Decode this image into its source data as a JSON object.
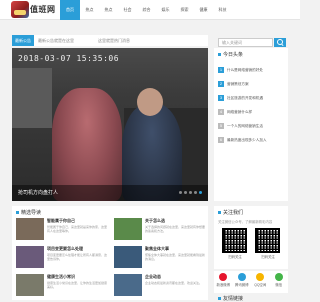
{
  "site": {
    "name": "值班网"
  },
  "nav": [
    "首页",
    "热点",
    "热点",
    "社会",
    "综合",
    "娱乐",
    "探索",
    "健康",
    "科技"
  ],
  "search": {
    "placeholder": "输入关键词"
  },
  "notice": {
    "badge": "最新公告",
    "text1": "最新公告就是在这里",
    "text2": "这里就是热门消息"
  },
  "hero": {
    "camera_text": "2018-03-07  15:35:06",
    "caption": "抢司机方向盘打人",
    "dot_count": 5,
    "active_dot": 4
  },
  "today": {
    "title": "今日头条",
    "items": [
      {
        "num": "1",
        "text": "什么是网络营销的好处",
        "hot": true
      },
      {
        "num": "2",
        "text": "营销策划方案",
        "hot": true
      },
      {
        "num": "3",
        "text": "社区旅游的开发和机遇",
        "hot": true
      },
      {
        "num": "4",
        "text": "网络营销什么样",
        "hot": false
      },
      {
        "num": "5",
        "text": "一个人的网络营销生活",
        "hot": false
      },
      {
        "num": "6",
        "text": "最新热度出现多少人加入",
        "hot": false
      }
    ]
  },
  "picks": {
    "title": "精选导读",
    "items": [
      {
        "title": "智能属于你自己",
        "desc": "智能属于你自己，来这里就是来你的家，这里有人在这里等你。"
      },
      {
        "title": "关于怎么选",
        "desc": "关于选择的问题就在这里，来这里就有你想要的答案和方法。"
      },
      {
        "title": "项目变更要怎么处理",
        "desc": "项目变更要怎么处理才能让所有人都满意，这里告诉你。"
      },
      {
        "title": "聚焦全体大事",
        "desc": "聚焦全体大事就在这里，来这里就能看到最新的消息。"
      },
      {
        "title": "健康生活小常识",
        "desc": "健康生活小常识在这里，让你的生活更加健康美好。"
      },
      {
        "title": "企业动态",
        "desc": "企业动态和最新资讯都在这里，欢迎关注。"
      }
    ]
  },
  "follow": {
    "title": "关注我们",
    "desc": "关注微信公众号，了解最新精彩内容",
    "qr1": "扫码关注",
    "qr2": "扫码关注"
  },
  "social": [
    {
      "label": "新浪微博",
      "color": "#e6162d"
    },
    {
      "label": "腾讯微博",
      "color": "#2b9ed8"
    },
    {
      "label": "QQ空间",
      "color": "#f7b500"
    },
    {
      "label": "微信",
      "color": "#44b549"
    }
  ],
  "friend": {
    "title": "友情链接"
  },
  "colors": {
    "accent": "#2b9ed8"
  }
}
